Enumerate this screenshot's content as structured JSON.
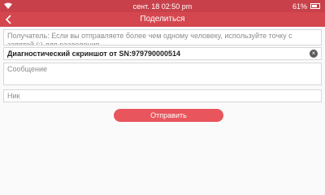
{
  "status_bar": {
    "time": "сент. 18  02:50 pm",
    "battery": "61%",
    "wifi_icon": "wifi-icon",
    "battery_icon": "battery-icon"
  },
  "toolbar": {
    "title": "Поделиться",
    "back_icon": "back-arrow-icon"
  },
  "form": {
    "recipient_placeholder": "Получатель: Если вы отправляете более чем одному человеку, используйте точку с запятой (;) для разделения",
    "subject_value": "Диагностический скриншот от SN:979790000514",
    "message_placeholder": "Сообщение",
    "nick_placeholder": "Ник",
    "clear_icon": "clear-icon"
  },
  "send_button": "Отправить",
  "colors": {
    "statusbar": "#c8414a",
    "toolbar": "#d5474f",
    "button": "#e9555c"
  }
}
